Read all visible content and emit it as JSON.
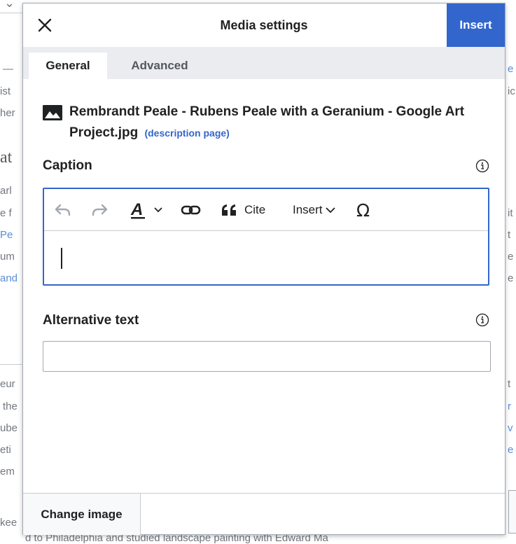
{
  "dialog": {
    "title": "Media settings",
    "insert_label": "Insert",
    "tabs": [
      {
        "label": "General",
        "active": true
      },
      {
        "label": "Advanced",
        "active": false
      }
    ],
    "file": {
      "name": "Rembrandt Peale - Rubens Peale with a Geranium - Google Art Project.jpg",
      "description_link": "(description page)"
    },
    "caption": {
      "label": "Caption",
      "value": "",
      "toolbar": {
        "cite_label": "Cite",
        "insert_label": "Insert"
      }
    },
    "alt_text": {
      "label": "Alternative text",
      "value": ""
    },
    "footer": {
      "change_image_label": "Change image"
    }
  },
  "background": {
    "left_fragments": [
      "—",
      "ist",
      "her",
      "at",
      "arl",
      "e f",
      "Pe",
      "um",
      "and",
      "eur",
      "the",
      "ube",
      "eti",
      "em",
      "kee"
    ],
    "right_fragments": [
      "e",
      "ic",
      "it",
      "t",
      "e",
      "e",
      "t",
      "r",
      "v",
      "e"
    ],
    "bottom_text": "d to Philadelphia and studied landscape painting with Edward Ma"
  },
  "colors": {
    "accent": "#3366cc",
    "border": "#a2a9b1",
    "tab_bar": "#eaecf0",
    "text": "#202122"
  }
}
